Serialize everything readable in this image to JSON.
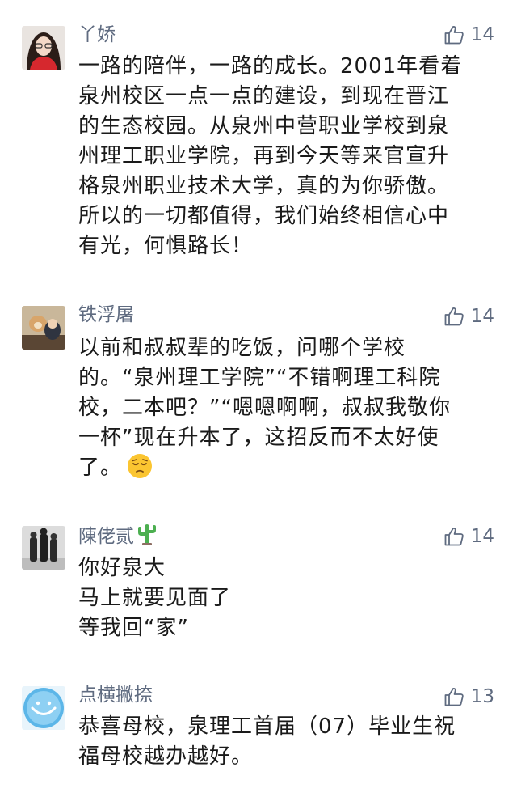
{
  "comments": [
    {
      "user": "丫娇",
      "likes": "14",
      "lines": [
        "一路的陪伴，一路的成长。2001年看着",
        "泉州校区一点一点的建设，到现在晋江",
        "的生态校园。从泉州中营职业学校到泉",
        "州理工职业学院，再到今天等来官宣升",
        "格泉州职业技术大学，真的为你骄傲。",
        "所以的一切都值得，我们始终相信心中",
        "有光，何惧路长！"
      ]
    },
    {
      "user": "铁浮屠",
      "likes": "14",
      "lines": [
        "以前和叔叔辈的吃饭，问哪个学校",
        "的。“泉州理工学院”“不错啊理工科院",
        "校，二本吧？”“嗯嗯啊啊，叔叔我敬你",
        "一杯”现在升本了，这招反而不太好使",
        "了。"
      ],
      "trailing_emoji": "pensive-face"
    },
    {
      "user": "陳佬贰",
      "user_emoji": "cactus",
      "likes": "14",
      "lines": [
        "你好泉大",
        "马上就要见面了",
        "等我回“家”"
      ]
    },
    {
      "user": "点横撇捺",
      "likes": "13",
      "lines": [
        "恭喜母校，泉理工首届（07）毕业生祝",
        "福母校越办越好。"
      ]
    }
  ],
  "icons": {
    "like": "thumbs-up-outline-icon"
  },
  "colors": {
    "name": "#5f6b80",
    "text": "#1a1a1a",
    "background": "#ffffff"
  }
}
